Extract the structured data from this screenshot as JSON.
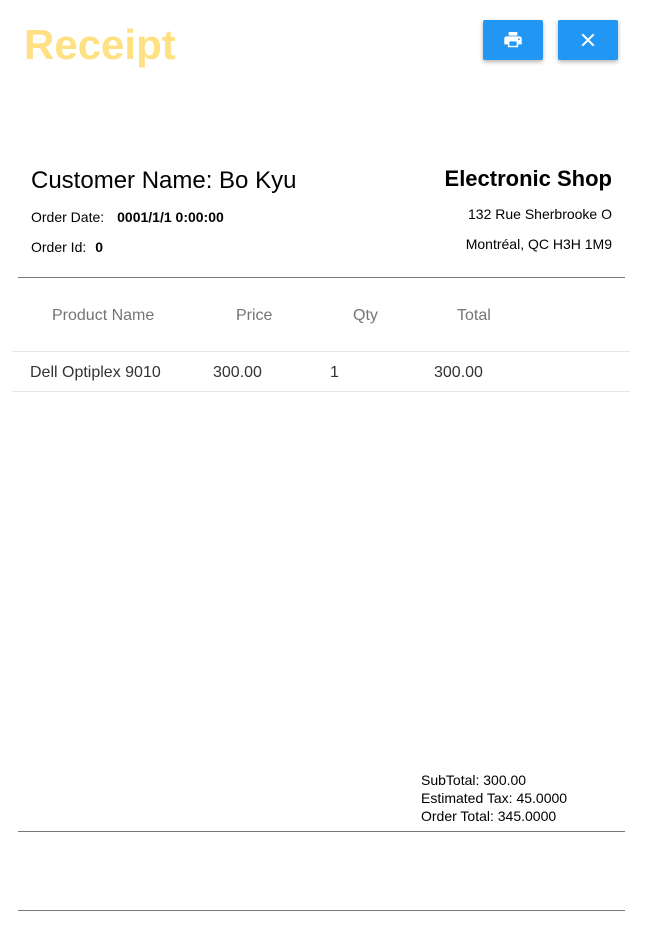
{
  "header": {
    "title": "Receipt",
    "print_button_icon": "printer-icon",
    "close_button_icon": "close-icon",
    "button_color": "#2196f3",
    "title_color": "#ffe082"
  },
  "customer": {
    "name_text": "Customer Name: Bo Kyu",
    "order_date_label": "Order Date:",
    "order_date_value": "0001/1/1 0:00:00",
    "order_id_label": "Order Id:",
    "order_id_value": "0"
  },
  "shop": {
    "name": "Electronic Shop",
    "address_line1": "132 Rue Sherbrooke O",
    "address_line2": "Montréal, QC H3H 1M9"
  },
  "table": {
    "headers": {
      "product": "Product Name",
      "price": "Price",
      "qty": "Qty",
      "total": "Total"
    },
    "rows": [
      {
        "product": "Dell Optiplex 9010",
        "price": "300.00",
        "qty": "1",
        "total": "300.00"
      }
    ]
  },
  "totals": {
    "subtotal": "SubTotal: 300.00",
    "tax": "Estimated Tax: 45.0000",
    "order_total": "Order Total: 345.0000"
  }
}
